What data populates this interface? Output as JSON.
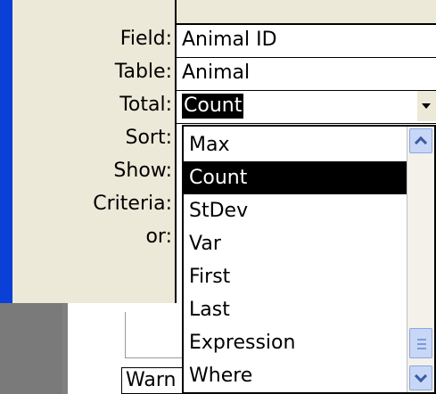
{
  "labels": {
    "field": "Field:",
    "table": "Table:",
    "total": "Total:",
    "sort": "Sort:",
    "show": "Show:",
    "criteria": "Criteria:",
    "or": "or:"
  },
  "column": {
    "field_value": "Animal ID",
    "table_value": "Animal",
    "total_value": "Count"
  },
  "dropdown": {
    "items": [
      "Max",
      "Count",
      "StDev",
      "Var",
      "First",
      "Last",
      "Expression",
      "Where"
    ],
    "selected": "Count"
  },
  "lower": {
    "warn_text": "Warn"
  },
  "icons": {
    "dropdown_arrow": "chevron-down-icon",
    "scroll_up": "chevron-up-icon",
    "scroll_down": "chevron-down-icon"
  }
}
